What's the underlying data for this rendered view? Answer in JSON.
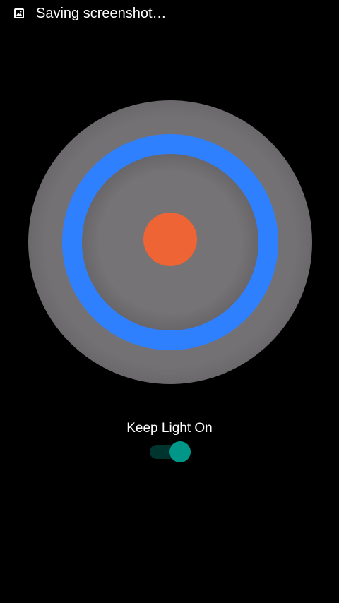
{
  "status_bar": {
    "icon": "image-icon",
    "notification_text": "Saving screenshot…"
  },
  "dial": {
    "outer_color": "#737173",
    "ring_color": "#2f80ff",
    "inner_color": "#737173",
    "center_color": "#ee6434"
  },
  "keep_light": {
    "label": "Keep Light On",
    "enabled": true,
    "accent_color": "#009688"
  }
}
